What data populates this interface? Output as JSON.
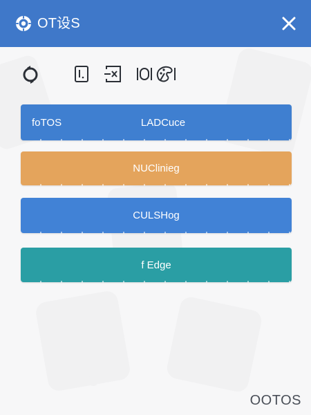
{
  "titlebar": {
    "title": "OT设S",
    "app_icon": "gear-ring-icon",
    "close_icon": "close-icon",
    "background": "#3f78c9"
  },
  "toolbar": {
    "tools": [
      {
        "icon": "refresh-ring-icon"
      },
      {
        "icon": "text-frame-icon"
      },
      {
        "icon": "close-box-icon"
      },
      {
        "icon": "pill-frame-icon"
      },
      {
        "icon": "palette-icon"
      }
    ]
  },
  "buttons": [
    {
      "left_label": "foTOS",
      "label": "LADCuce",
      "color": "#3f7fd0"
    },
    {
      "label": "NUClinieg",
      "color": "#e4a45c"
    },
    {
      "label": "CULSHog",
      "color": "#4182d6"
    },
    {
      "label": "f Edge",
      "color": "#2a9ea4"
    }
  ],
  "footer": {
    "text": "OOTOS"
  }
}
